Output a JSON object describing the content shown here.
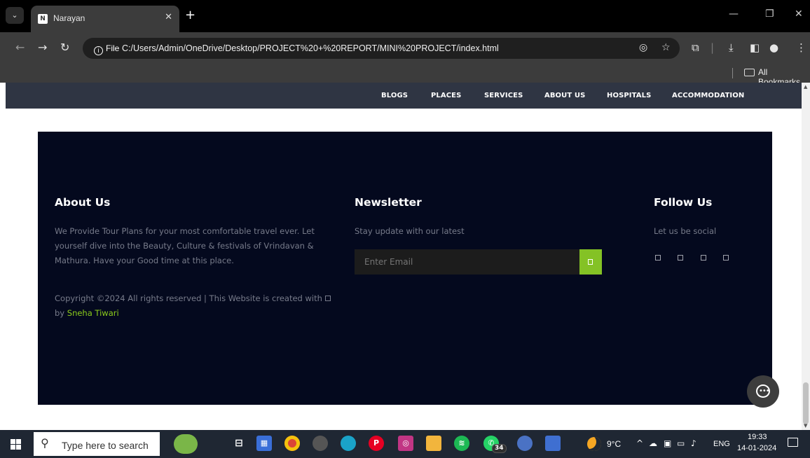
{
  "browser": {
    "tab_title": "Narayan",
    "favicon_letter": "N",
    "url_info_label": "File",
    "url": "C:/Users/Admin/OneDrive/Desktop/PROJECT%20+%20REPORT/MINI%20PROJECT/index.html",
    "bookmarks_label": "All Bookmarks"
  },
  "site_nav": {
    "items": [
      "BLOGS",
      "PLACES",
      "SERVICES",
      "ABOUT US",
      "HOSPITALS",
      "ACCOMMODATION"
    ]
  },
  "footer": {
    "about": {
      "title": "About Us",
      "text": "We Provide Tour Plans for your most comfortable travel ever. Let yourself dive into the Beauty, Culture & festivals of Vrindavan & Mathura. Have your Good time at this place.",
      "copyright_prefix": "Copyright ©2024 All rights reserved | This Website is created with",
      "copyright_by": "by",
      "author": "Sneha Tiwari"
    },
    "newsletter": {
      "title": "Newsletter",
      "subtitle": "Stay update with our latest",
      "email_placeholder": "Enter Email"
    },
    "follow": {
      "title": "Follow Us",
      "subtitle": "Let us be social"
    }
  },
  "taskbar": {
    "search_placeholder": "Type here to search",
    "whatsapp_badge": "34",
    "temperature": "9°C",
    "language": "ENG",
    "time": "19:33",
    "date": "14-01-2024"
  },
  "colors": {
    "footer_bg": "#04091e",
    "nav_bg": "#2f3543",
    "accent_green": "#84c225",
    "author_green": "#8ccc1c"
  }
}
